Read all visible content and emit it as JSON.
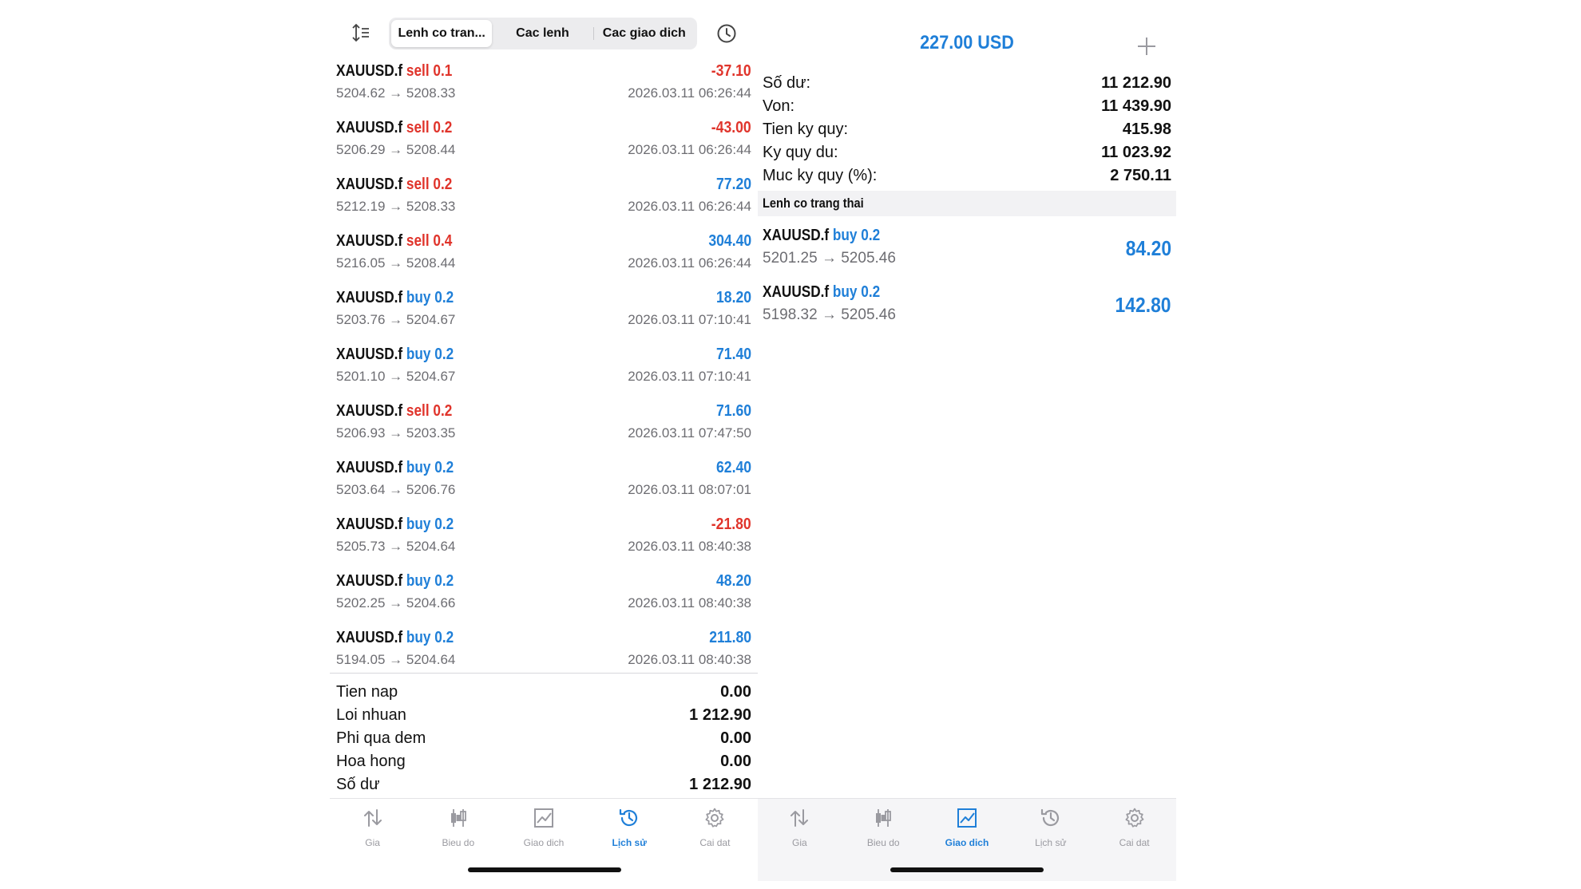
{
  "history": {
    "segments": [
      "Lenh co tran...",
      "Cac lenh",
      "Cac giao dich"
    ],
    "active_segment": 0,
    "deals": [
      {
        "symbol": "XAUUSD.f",
        "side": "sell 0.1",
        "side_color": "#e0342b",
        "prices": "5204.62 → 5208.33",
        "profit": "-37.10",
        "profit_color": "#e0342b",
        "time": "2026.03.11 06:26:44"
      },
      {
        "symbol": "XAUUSD.f",
        "side": "sell 0.2",
        "side_color": "#e0342b",
        "prices": "5206.29 → 5208.44",
        "profit": "-43.00",
        "profit_color": "#e0342b",
        "time": "2026.03.11 06:26:44"
      },
      {
        "symbol": "XAUUSD.f",
        "side": "sell 0.2",
        "side_color": "#e0342b",
        "prices": "5212.19 → 5208.33",
        "profit": "77.20",
        "profit_color": "#1f7fd8",
        "time": "2026.03.11 06:26:44"
      },
      {
        "symbol": "XAUUSD.f",
        "side": "sell 0.4",
        "side_color": "#e0342b",
        "prices": "5216.05 → 5208.44",
        "profit": "304.40",
        "profit_color": "#1f7fd8",
        "time": "2026.03.11 06:26:44"
      },
      {
        "symbol": "XAUUSD.f",
        "side": "buy 0.2",
        "side_color": "#1f7fd8",
        "prices": "5203.76 → 5204.67",
        "profit": "18.20",
        "profit_color": "#1f7fd8",
        "time": "2026.03.11 07:10:41"
      },
      {
        "symbol": "XAUUSD.f",
        "side": "buy 0.2",
        "side_color": "#1f7fd8",
        "prices": "5201.10 → 5204.67",
        "profit": "71.40",
        "profit_color": "#1f7fd8",
        "time": "2026.03.11 07:10:41"
      },
      {
        "symbol": "XAUUSD.f",
        "side": "sell 0.2",
        "side_color": "#e0342b",
        "prices": "5206.93 → 5203.35",
        "profit": "71.60",
        "profit_color": "#1f7fd8",
        "time": "2026.03.11 07:47:50"
      },
      {
        "symbol": "XAUUSD.f",
        "side": "buy 0.2",
        "side_color": "#1f7fd8",
        "prices": "5203.64 → 5206.76",
        "profit": "62.40",
        "profit_color": "#1f7fd8",
        "time": "2026.03.11 08:07:01"
      },
      {
        "symbol": "XAUUSD.f",
        "side": "buy 0.2",
        "side_color": "#1f7fd8",
        "prices": "5205.73 → 5204.64",
        "profit": "-21.80",
        "profit_color": "#e0342b",
        "time": "2026.03.11 08:40:38"
      },
      {
        "symbol": "XAUUSD.f",
        "side": "buy 0.2",
        "side_color": "#1f7fd8",
        "prices": "5202.25 → 5204.66",
        "profit": "48.20",
        "profit_color": "#1f7fd8",
        "time": "2026.03.11 08:40:38"
      },
      {
        "symbol": "XAUUSD.f",
        "side": "buy 0.2",
        "side_color": "#1f7fd8",
        "prices": "5194.05 → 5204.64",
        "profit": "211.80",
        "profit_color": "#1f7fd8",
        "time": "2026.03.11 08:40:38"
      }
    ],
    "summary": [
      {
        "label": "Tien nap",
        "value": "0.00"
      },
      {
        "label": "Loi nhuan",
        "value": "1 212.90"
      },
      {
        "label": "Phi qua dem",
        "value": "0.00"
      },
      {
        "label": "Hoa hong",
        "value": "0.00"
      },
      {
        "label": "Số dư",
        "value": "1 212.90"
      }
    ],
    "tabs": [
      {
        "label": "Gia",
        "icon": "price-arrows-icon",
        "active": false
      },
      {
        "label": "Bieu do",
        "icon": "candlestick-icon",
        "active": false
      },
      {
        "label": "Giao dich",
        "icon": "trade-chart-icon",
        "active": false
      },
      {
        "label": "Lịch sử",
        "icon": "history-clock-icon",
        "active": true
      },
      {
        "label": "Cai dat",
        "icon": "gear-icon",
        "active": false
      }
    ]
  },
  "trade": {
    "balance_title": "227.00 USD",
    "account": [
      {
        "label": "Số dư:",
        "value": "11 212.90"
      },
      {
        "label": "Von:",
        "value": "11 439.90"
      },
      {
        "label": "Tien ky quy:",
        "value": "415.98"
      },
      {
        "label": "Ky quy du:",
        "value": "11 023.92"
      },
      {
        "label": "Muc ky quy (%):",
        "value": "2 750.11"
      }
    ],
    "section_title": "Lenh co trang thai",
    "positions": [
      {
        "symbol": "XAUUSD.f",
        "side": "buy 0.2",
        "side_color": "#1f7fd8",
        "prices": "5201.25 → 5205.46",
        "profit": "84.20"
      },
      {
        "symbol": "XAUUSD.f",
        "side": "buy 0.2",
        "side_color": "#1f7fd8",
        "prices": "5198.32 → 5205.46",
        "profit": "142.80"
      }
    ],
    "tabs": [
      {
        "label": "Gia",
        "icon": "price-arrows-icon",
        "active": false
      },
      {
        "label": "Bieu do",
        "icon": "candlestick-icon",
        "active": false
      },
      {
        "label": "Giao dich",
        "icon": "trade-chart-icon",
        "active": true
      },
      {
        "label": "Lịch sử",
        "icon": "history-clock-icon",
        "active": false
      },
      {
        "label": "Cai dat",
        "icon": "gear-icon",
        "active": false
      }
    ]
  },
  "colors": {
    "accent": "#1f7fd8",
    "loss": "#e0342b",
    "muted": "#6d6d72",
    "tab_inactive": "#9a9aa0"
  }
}
